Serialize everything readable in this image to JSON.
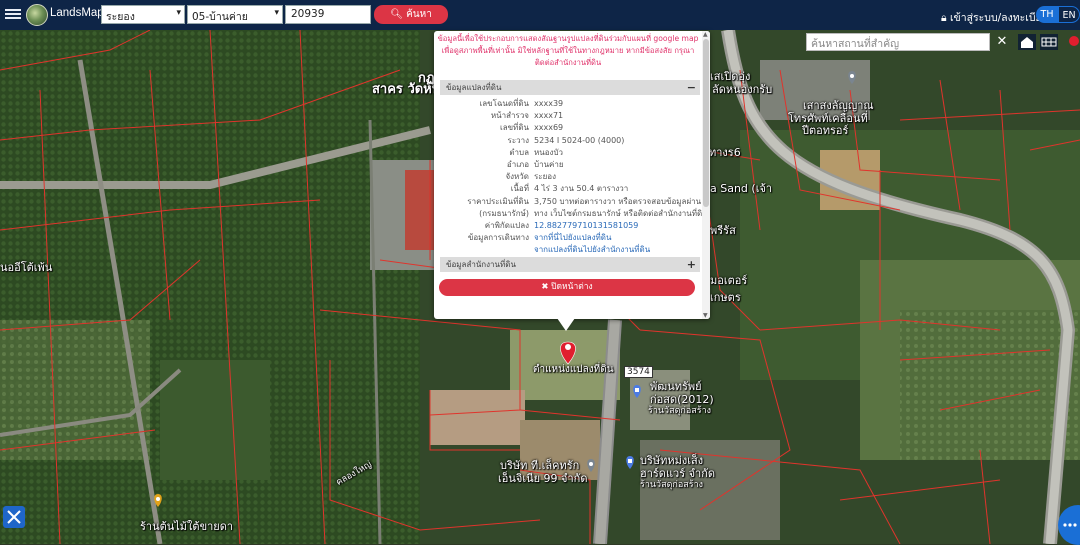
{
  "app": {
    "brand": "LandsMaps"
  },
  "filters": {
    "province": "ระยอง",
    "district": "05-บ้านค่าย",
    "deed_number": "20939",
    "search_label": "ค้นหา"
  },
  "header": {
    "login_label": "เข้าสู่ระบบ/ลงทะเบียน",
    "lang_th": "TH",
    "lang_en": "EN"
  },
  "map_search": {
    "placeholder": "ค้นหาสถานที่สำคัญ",
    "close": "✕"
  },
  "popup": {
    "notice_line1": "ข้อมูลนี้เพื่อใช้ประกอบการแสดงสัณฐานรูปแปลงที่ดินร่วมกับแผนที่ google map",
    "notice_line2": "เพื่อดูสภาพพื้นที่เท่านั้น มิใช่หลักฐานที่ใช้ในทางกฎหมาย หากมีข้อสงสัย กรุณา",
    "notice_line3": "ติดต่อสำนักงานที่ดิน",
    "section_land": "ข้อมูลแปลงที่ดิน",
    "section_office": "ข้อมูลสำนักงานที่ดิน",
    "minus": "−",
    "plus": "+",
    "rows": [
      {
        "k": "เลขโฉนดที่ดิน",
        "v": "xxxx39"
      },
      {
        "k": "หน้าสำรวจ",
        "v": "xxxx71"
      },
      {
        "k": "เลขที่ดิน",
        "v": "xxxx69"
      },
      {
        "k": "ระวาง",
        "v": "5234 I 5024-00 (4000)"
      },
      {
        "k": "ตำบล",
        "v": "หนองบัว"
      },
      {
        "k": "อำเภอ",
        "v": "บ้านค่าย"
      },
      {
        "k": "จังหวัด",
        "v": "ระยอง"
      },
      {
        "k": "เนื้อที่",
        "v": "4 ไร่ 3 งาน 50.4 ตารางวา"
      },
      {
        "k": "ราคาประเมินที่ดิน",
        "v": "3,750 บาทต่อตารางวา หรือตรวจสอบข้อมูลผ่าน"
      },
      {
        "k": "(กรมธนารักษ์)",
        "v": "ทาง เว็บไซต์กรมธนารักษ์ หรือติดต่อสำนักงานที่ดิน"
      },
      {
        "k": "ค่าพิกัดแปลง",
        "v": "12.882779710131581059"
      },
      {
        "k": "ข้อมูลการเดินทาง",
        "v": "จากที่นี่ไปยังแปลงที่ดิน"
      },
      {
        "k": "",
        "v": "จากแปลงที่ดินไปยังสำนักงานที่ดิน"
      }
    ],
    "close_label": "ปิดหน้าต่าง"
  },
  "map_labels": {
    "l1": "กฏทิ",
    "l2": "สาคร วัดหน",
    "l3": "เสเปิดอุ่ง",
    "l4": "ลัดหนองกรับ",
    "l5": "เสาสงลัญญาณ",
    "l6": "โทรศัพท์เคลื่อนที่",
    "l7": "ปีตอทรอร์",
    "l8": "ทางร6",
    "l9": "a Sand (เจ้า",
    "l10": "พรีรัส",
    "l11": "มอเตอร์",
    "l12": "เกษตร",
    "l13": "นออีโต้เพ้น",
    "l14": "ตำแหน่งแปลงที่ดิน",
    "l15": "3574",
    "l16": "พัฒนทรัพย์",
    "l17": "ก่อสด(2012)",
    "l18": "ร้านวัสดุก่อสร้าง",
    "l19": "บริษัทหม่งเส็ง",
    "l20": "ฮาร์ดแวร์ จำกัด",
    "l21": "ร้านวัสดุก่อสร้าง",
    "l22": "บริษัท ที.เล็คทรัก",
    "l23": "เอ็นจิเนีย 99 จำกัด",
    "l24": "ร้านต้นไม้ใต้ขายดา",
    "l25": "คลองใหญ่"
  },
  "colors": {
    "topbar": "#0e2547",
    "accent_red": "#dc3545",
    "lang_active": "#1a6fd6",
    "parcel_line": "#e0342c",
    "notice_text": "#e0326a"
  }
}
